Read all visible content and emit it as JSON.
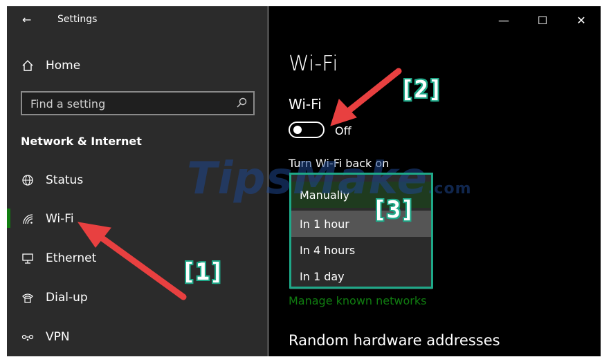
{
  "window": {
    "title": "Settings",
    "controls": {
      "minimize": "—",
      "maximize": "☐",
      "close": "✕"
    }
  },
  "sidebar": {
    "home": "Home",
    "search_placeholder": "Find a setting",
    "section": "Network & Internet",
    "items": [
      {
        "label": "Status",
        "icon": "globe-icon"
      },
      {
        "label": "Wi-Fi",
        "icon": "wifi-icon",
        "selected": true
      },
      {
        "label": "Ethernet",
        "icon": "ethernet-icon"
      },
      {
        "label": "Dial-up",
        "icon": "dialup-icon"
      },
      {
        "label": "VPN",
        "icon": "vpn-icon"
      }
    ]
  },
  "main": {
    "page_title": "Wi-Fi",
    "wifi_label": "Wi-Fi",
    "toggle_state": "Off",
    "turn_back_on_label": "Turn Wi-Fi back on",
    "dropdown_options": [
      "Manually",
      "In 1 hour",
      "In 4 hours",
      "In 1 day"
    ],
    "dropdown_highlighted": "In 1 hour",
    "manage_link": "Manage known networks",
    "random_hw_title": "Random hardware addresses"
  },
  "annotations": {
    "a1": "[1]",
    "a2": "[2]",
    "a3": "[3]",
    "box_color": "#1ea888",
    "arrow_color": "#e84040"
  },
  "watermark": {
    "text": "TipsMake",
    "suffix": ".com"
  },
  "colors": {
    "accent": "#107c10",
    "sidebar_bg": "#2b2b2b",
    "main_bg": "#000000"
  }
}
